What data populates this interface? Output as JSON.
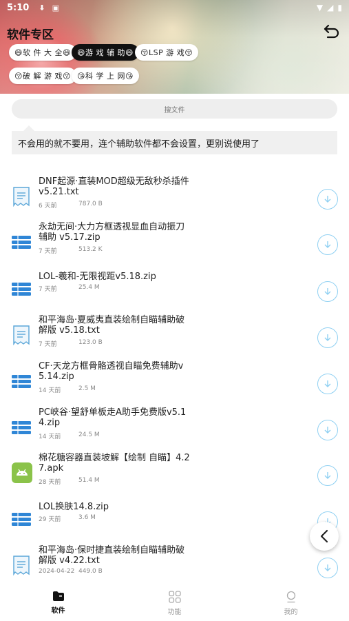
{
  "status_bar": {
    "time": "5:10"
  },
  "header": {
    "title": "软件专区"
  },
  "chips": [
    {
      "label": "😄软 件 大 全😄",
      "active": false
    },
    {
      "label": "😄游 戏 辅 助😄",
      "active": true
    },
    {
      "label": "😚LSP 游 戏😚",
      "active": false
    },
    {
      "label": "😚破 解 游 戏😚",
      "active": false
    },
    {
      "label": "😘科 学 上 网😘",
      "active": false
    }
  ],
  "search": {
    "placeholder": "搜文件"
  },
  "notice": "不会用的就不要用，连个辅助软件都不会设置，更别说使用了",
  "files": [
    {
      "name": "DNF起源·直装MOD超级无敌秒杀插件 v5.21.txt",
      "date": "6 天前",
      "size": "787.0 B",
      "type": "txt"
    },
    {
      "name": "永劫无间·大力方框透视显血自动振刀辅助 v5.17.zip",
      "date": "7 天前",
      "size": "513.2 K",
      "type": "zip"
    },
    {
      "name": "LOL-羲和-无限视距v5.18.zip",
      "date": "7 天前",
      "size": "25.4 M",
      "type": "zip"
    },
    {
      "name": "和平海岛·夏威夷直装绘制自瞄辅助破解版 v5.18.txt",
      "date": "7 天前",
      "size": "123.0 B",
      "type": "txt"
    },
    {
      "name": "CF·天龙方框骨骼透视自瞄免费辅助v5.14.zip",
      "date": "14 天前",
      "size": "2.5 M",
      "type": "zip"
    },
    {
      "name": "PC峡谷·望舒单板走A助手免费版v5.14.zip",
      "date": "14 天前",
      "size": "24.5 M",
      "type": "zip"
    },
    {
      "name": "棉花糖容器直装坡解【绘制 自瞄】4.27.apk",
      "date": "28 天前",
      "size": "51.4 M",
      "type": "apk"
    },
    {
      "name": "LOL换肤14.8.zip",
      "date": "29 天前",
      "size": "3.6 M",
      "type": "zip"
    },
    {
      "name": "和平海岛·保时捷直装绘制自瞄辅助破解版 v4.22.txt",
      "date": "2024-04-22",
      "size": "449.0 B",
      "type": "txt"
    }
  ],
  "bottom_nav": [
    {
      "label": "软件",
      "active": true,
      "icon": "folder-icon"
    },
    {
      "label": "功能",
      "active": false,
      "icon": "grid-icon"
    },
    {
      "label": "我的",
      "active": false,
      "icon": "profile-icon"
    }
  ],
  "colors": {
    "accent_download": "#8fd0f2",
    "zip_icon": "#2f86d6",
    "apk_icon": "#8bc34a",
    "txt_icon": "#5aa6d8"
  }
}
